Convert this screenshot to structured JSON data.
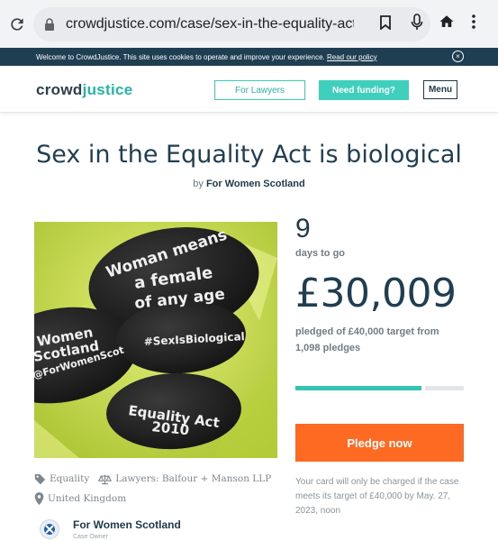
{
  "browser": {
    "url": "crowdjustice.com/case/sex-in-the-equality-act-is-biologi"
  },
  "cookie_banner": {
    "text": "Welcome to CrowdJustice. This site uses cookies to operate and improve your experience.",
    "link": "Read our policy"
  },
  "header": {
    "logo_crowd": "crowd",
    "logo_justice": "justice",
    "for_lawyers": "For Lawyers",
    "need_funding": "Need funding?",
    "menu": "Menu"
  },
  "campaign": {
    "title": "Sex in the Equality Act is biological",
    "by_prefix": "by",
    "by_name": "For Women Scotland",
    "image_text": {
      "stone1": [
        "Woman means",
        "a female",
        "of any age"
      ],
      "stone2": [
        "#SexIsBiological"
      ],
      "stone3": [
        "Women",
        "Scotland",
        "@ForWomenScot"
      ],
      "stone4": [
        "Equality Act",
        "2010"
      ]
    }
  },
  "stats": {
    "days": "9",
    "days_label": "days to go",
    "amount": "£30,009",
    "pledged_text": "pledged of £40,000 target from 1,098 pledges",
    "progress_fraction": 0.75,
    "pledge_button": "Pledge now",
    "charge_note": "Your card will only be charged if the case meets its target of £40,000 by May. 27, 2023, noon"
  },
  "tags": {
    "category": "Equality",
    "lawyers": "Lawyers: Balfour + Manson LLP",
    "location": "United Kingdom"
  },
  "owner": {
    "name": "For Women Scotland",
    "role": "Case Owner"
  },
  "colors": {
    "brand_teal": "#3fcfbd",
    "pledge_orange": "#ff6a22",
    "navy": "#1f3e52"
  }
}
